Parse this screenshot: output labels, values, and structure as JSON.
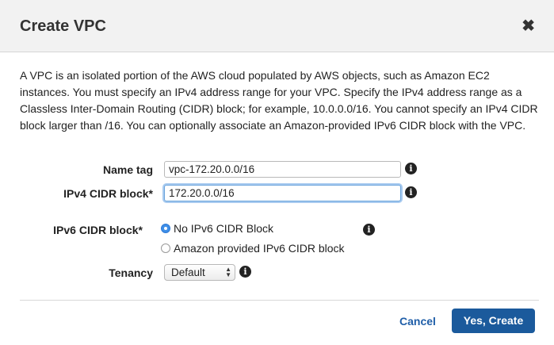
{
  "dialog": {
    "title": "Create VPC",
    "close_glyph": "✖",
    "description": "A VPC is an isolated portion of the AWS cloud populated by AWS objects, such as Amazon EC2 instances. You must specify an IPv4 address range for your VPC. Specify the IPv4 address range as a Classless Inter-Domain Routing (CIDR) block; for example, 10.0.0.0/16. You cannot specify an IPv4 CIDR block larger than /16. You can optionally associate an Amazon-provided IPv6 CIDR block with the VPC."
  },
  "form": {
    "name_tag": {
      "label": "Name tag",
      "value": "vpc-172.20.0.0/16"
    },
    "ipv4_cidr": {
      "label": "IPv4 CIDR block*",
      "value": "172.20.0.0/16"
    },
    "ipv6_cidr": {
      "label": "IPv6 CIDR block*",
      "options": [
        {
          "label": "No IPv6 CIDR Block",
          "checked": true
        },
        {
          "label": "Amazon provided IPv6 CIDR block",
          "checked": false
        }
      ]
    },
    "tenancy": {
      "label": "Tenancy",
      "selected": "Default"
    },
    "info_glyph": "i"
  },
  "footer": {
    "cancel_label": "Cancel",
    "create_label": "Yes, Create"
  },
  "colors": {
    "primary_button": "#1b5a9c",
    "link": "#1f5ea8",
    "focus_ring": "#a9cbf0",
    "radio_checked": "#3f8fe8"
  },
  "icons": {
    "close": "close-icon",
    "info": "info-icon",
    "select_arrows": "up-down-arrows-icon"
  }
}
